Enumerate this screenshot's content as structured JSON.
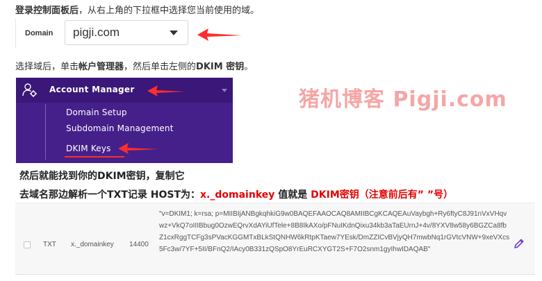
{
  "instructions": {
    "line1_bold": "登录控制面板后",
    "line1_rest": "，从右上角的下拉框中选择您当前使用的域。",
    "line2_pre": "选择域后，单击",
    "line2_bold1": "帐户管理器",
    "line2_mid": "，然后单击左侧的",
    "line2_bold2": "DKIM 密钥",
    "line2_end": "。",
    "line3": "然后就能找到你的DKIM密钥，复制它",
    "line4_pre": "去域名那边解析一个TXT记录 HOST为：",
    "line4_host": "x._domainkey",
    "line4_mid": " 值就是 ",
    "line4_val": "DKIM密钥（注意前后有”  ”号）"
  },
  "domain_selector": {
    "label": "Domain",
    "value": "pigji.com"
  },
  "account_menu": {
    "title": "Account Manager",
    "items": [
      "Domain Setup",
      "Subdomain Management",
      "DKIM Keys"
    ]
  },
  "watermark": "猪机博客 Pigji.com",
  "dns_record": {
    "type": "TXT",
    "host": "x._domainkey",
    "ttl": "14400",
    "value": "\"v=DKIM1; k=rsa; p=MIIBIjANBgkqhkiG9w0BAQEFAAOCAQ8AMIIBCgKCAQEAuVaybgh+Ry6ftyC8J91nVxVHqvwz+VkQ7oIIIBbug0OzwEQrvXdAYiUfTele+8B8IkAXo/pFNuIKdnQixu34kb3aTaEUrnJ+4v/8YXV8w58y6BGZCa8fbZ1cxRggTCFg3sPVacKGGMTxBLkStQNHW6kRtpKTaew7YEsk/DmZZICvBVjyQH7mwbNq1rGVtcVNW+9xeVXcs5Fc3w/7YF+5II/BFnQ2/IAcy0B331zQSpO8YrEuRCXYGT2S+F7O2snm1gyIhwIDAQAB\""
  },
  "colors": {
    "menu_bg": "#45208a",
    "arrow": "#ff2d2d",
    "highlight_red": "#e60000",
    "edit_icon": "#6c3fd0"
  }
}
